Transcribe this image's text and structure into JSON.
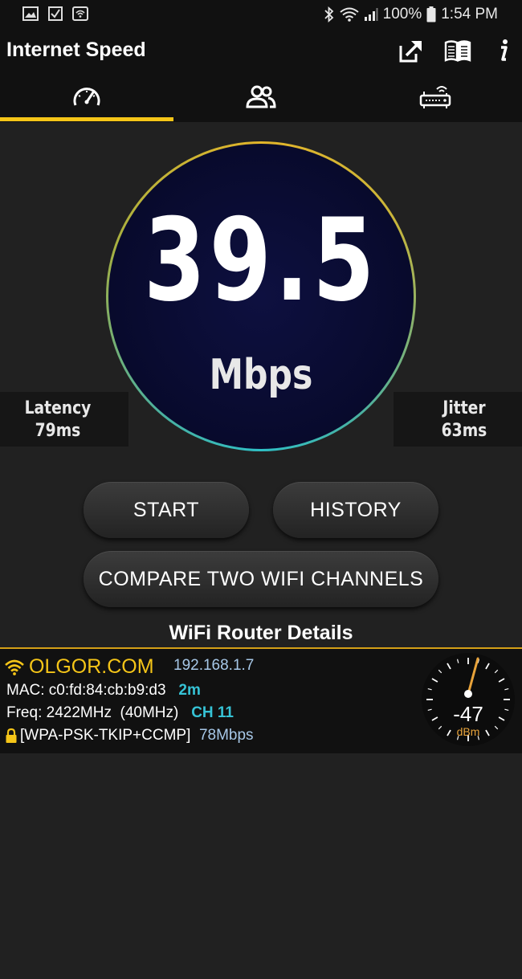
{
  "status_bar": {
    "battery": "100%",
    "time": "1:54 PM",
    "left_icons": [
      "image-icon",
      "checkbox-icon",
      "wifi-icon"
    ],
    "right_icons": [
      "bluetooth-icon",
      "wifi-signal-icon",
      "cell-signal-icon",
      "battery-icon"
    ]
  },
  "app_bar": {
    "title": "Internet Speed",
    "actions": [
      "share-icon",
      "book-icon",
      "info-icon"
    ]
  },
  "tabs": [
    {
      "icon": "speedometer-icon",
      "active": true
    },
    {
      "icon": "users-icon",
      "active": false
    },
    {
      "icon": "router-icon",
      "active": false
    }
  ],
  "speed": {
    "value": "39.5",
    "unit": "Mbps"
  },
  "latency": {
    "label": "Latency",
    "value": "79ms"
  },
  "jitter": {
    "label": "Jitter",
    "value": "63ms"
  },
  "buttons": {
    "start": "START",
    "history": "HISTORY",
    "compare": "COMPARE TWO WIFI CHANNELS"
  },
  "router_section": {
    "title": "WiFi Router Details",
    "ssid": "OLGOR.COM",
    "ip": "192.168.1.7",
    "mac_prefix": "MAC: c0:fd:84:cb:b9:d3",
    "distance": "2m",
    "freq": "Freq: 2422MHz  (40MHz)",
    "channel": "CH 11",
    "security": "[WPA-PSK-TKIP+CCMP]",
    "link_speed": "78Mbps",
    "signal_value": "-47",
    "signal_unit": "dBm"
  },
  "colors": {
    "accent": "#f5c518",
    "cyan": "#36c3d6",
    "ip_blue": "#a7c8e8",
    "background": "#212121"
  }
}
